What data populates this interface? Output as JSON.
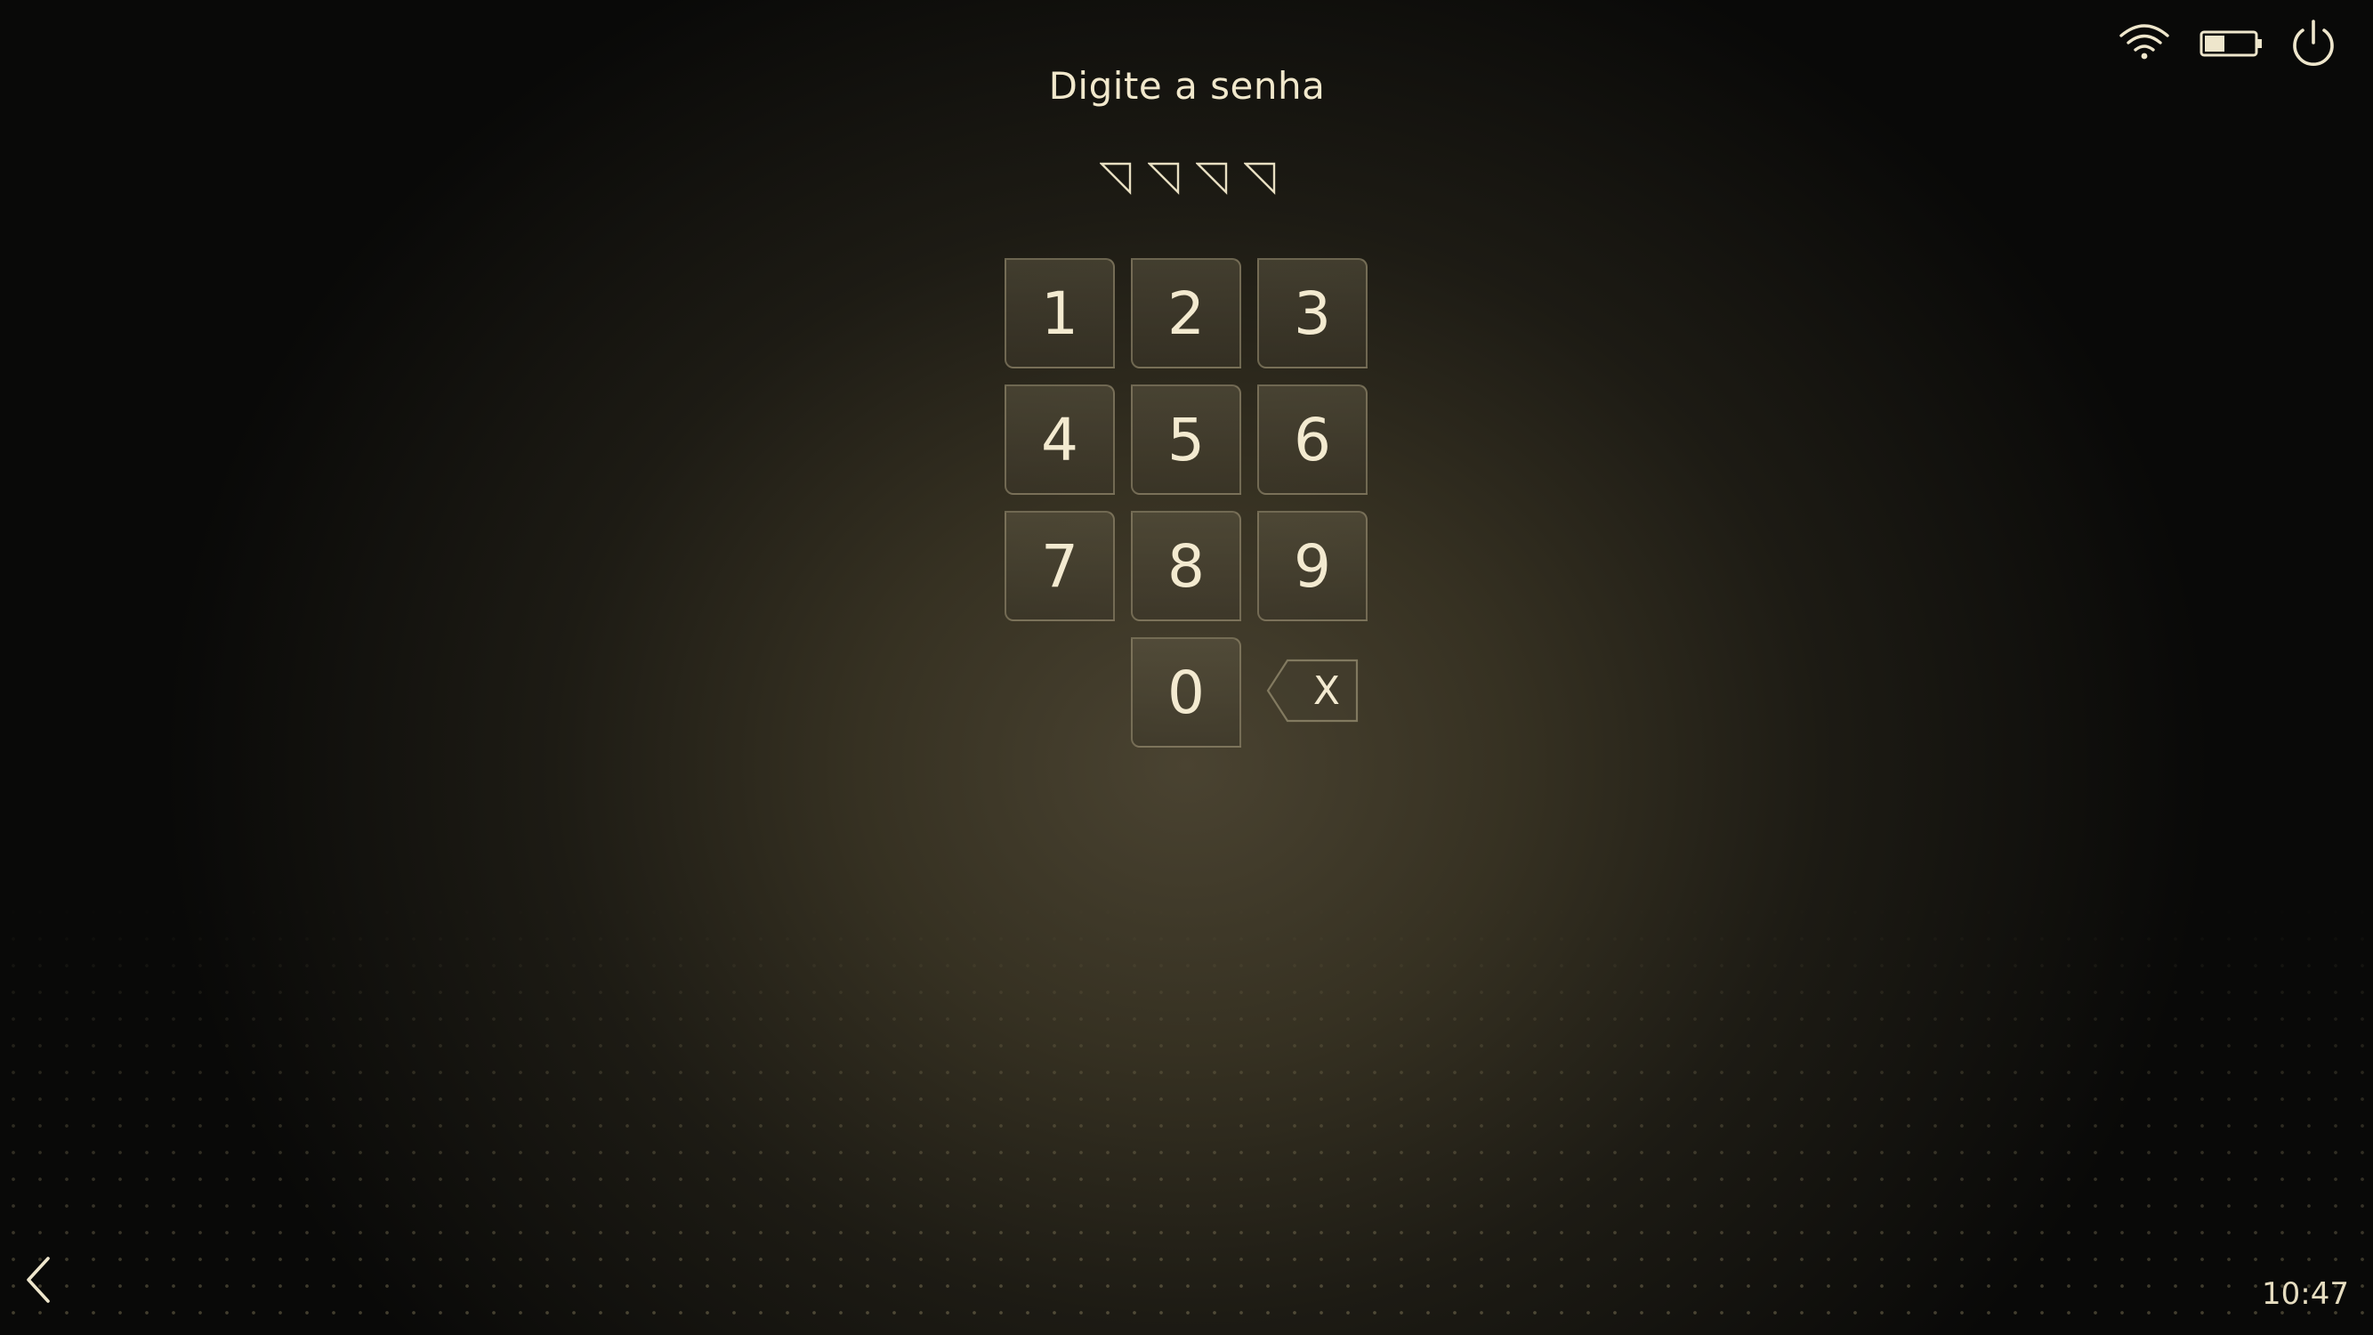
{
  "prompt": "Digite a senha",
  "pin": {
    "length": 4,
    "entered": 0
  },
  "keypad": {
    "keys": [
      "1",
      "2",
      "3",
      "4",
      "5",
      "6",
      "7",
      "8",
      "9",
      "0"
    ],
    "backspace_label": "X"
  },
  "status_bar": {
    "icons": [
      "wifi-icon",
      "battery-icon",
      "power-icon"
    ],
    "battery_level": 0.4
  },
  "footer": {
    "back_icon": "chevron-left-icon",
    "time": "10:47"
  },
  "colors": {
    "text": "#f1e8cc",
    "key_border": "#a09678",
    "background_glow": "#4a4331"
  }
}
